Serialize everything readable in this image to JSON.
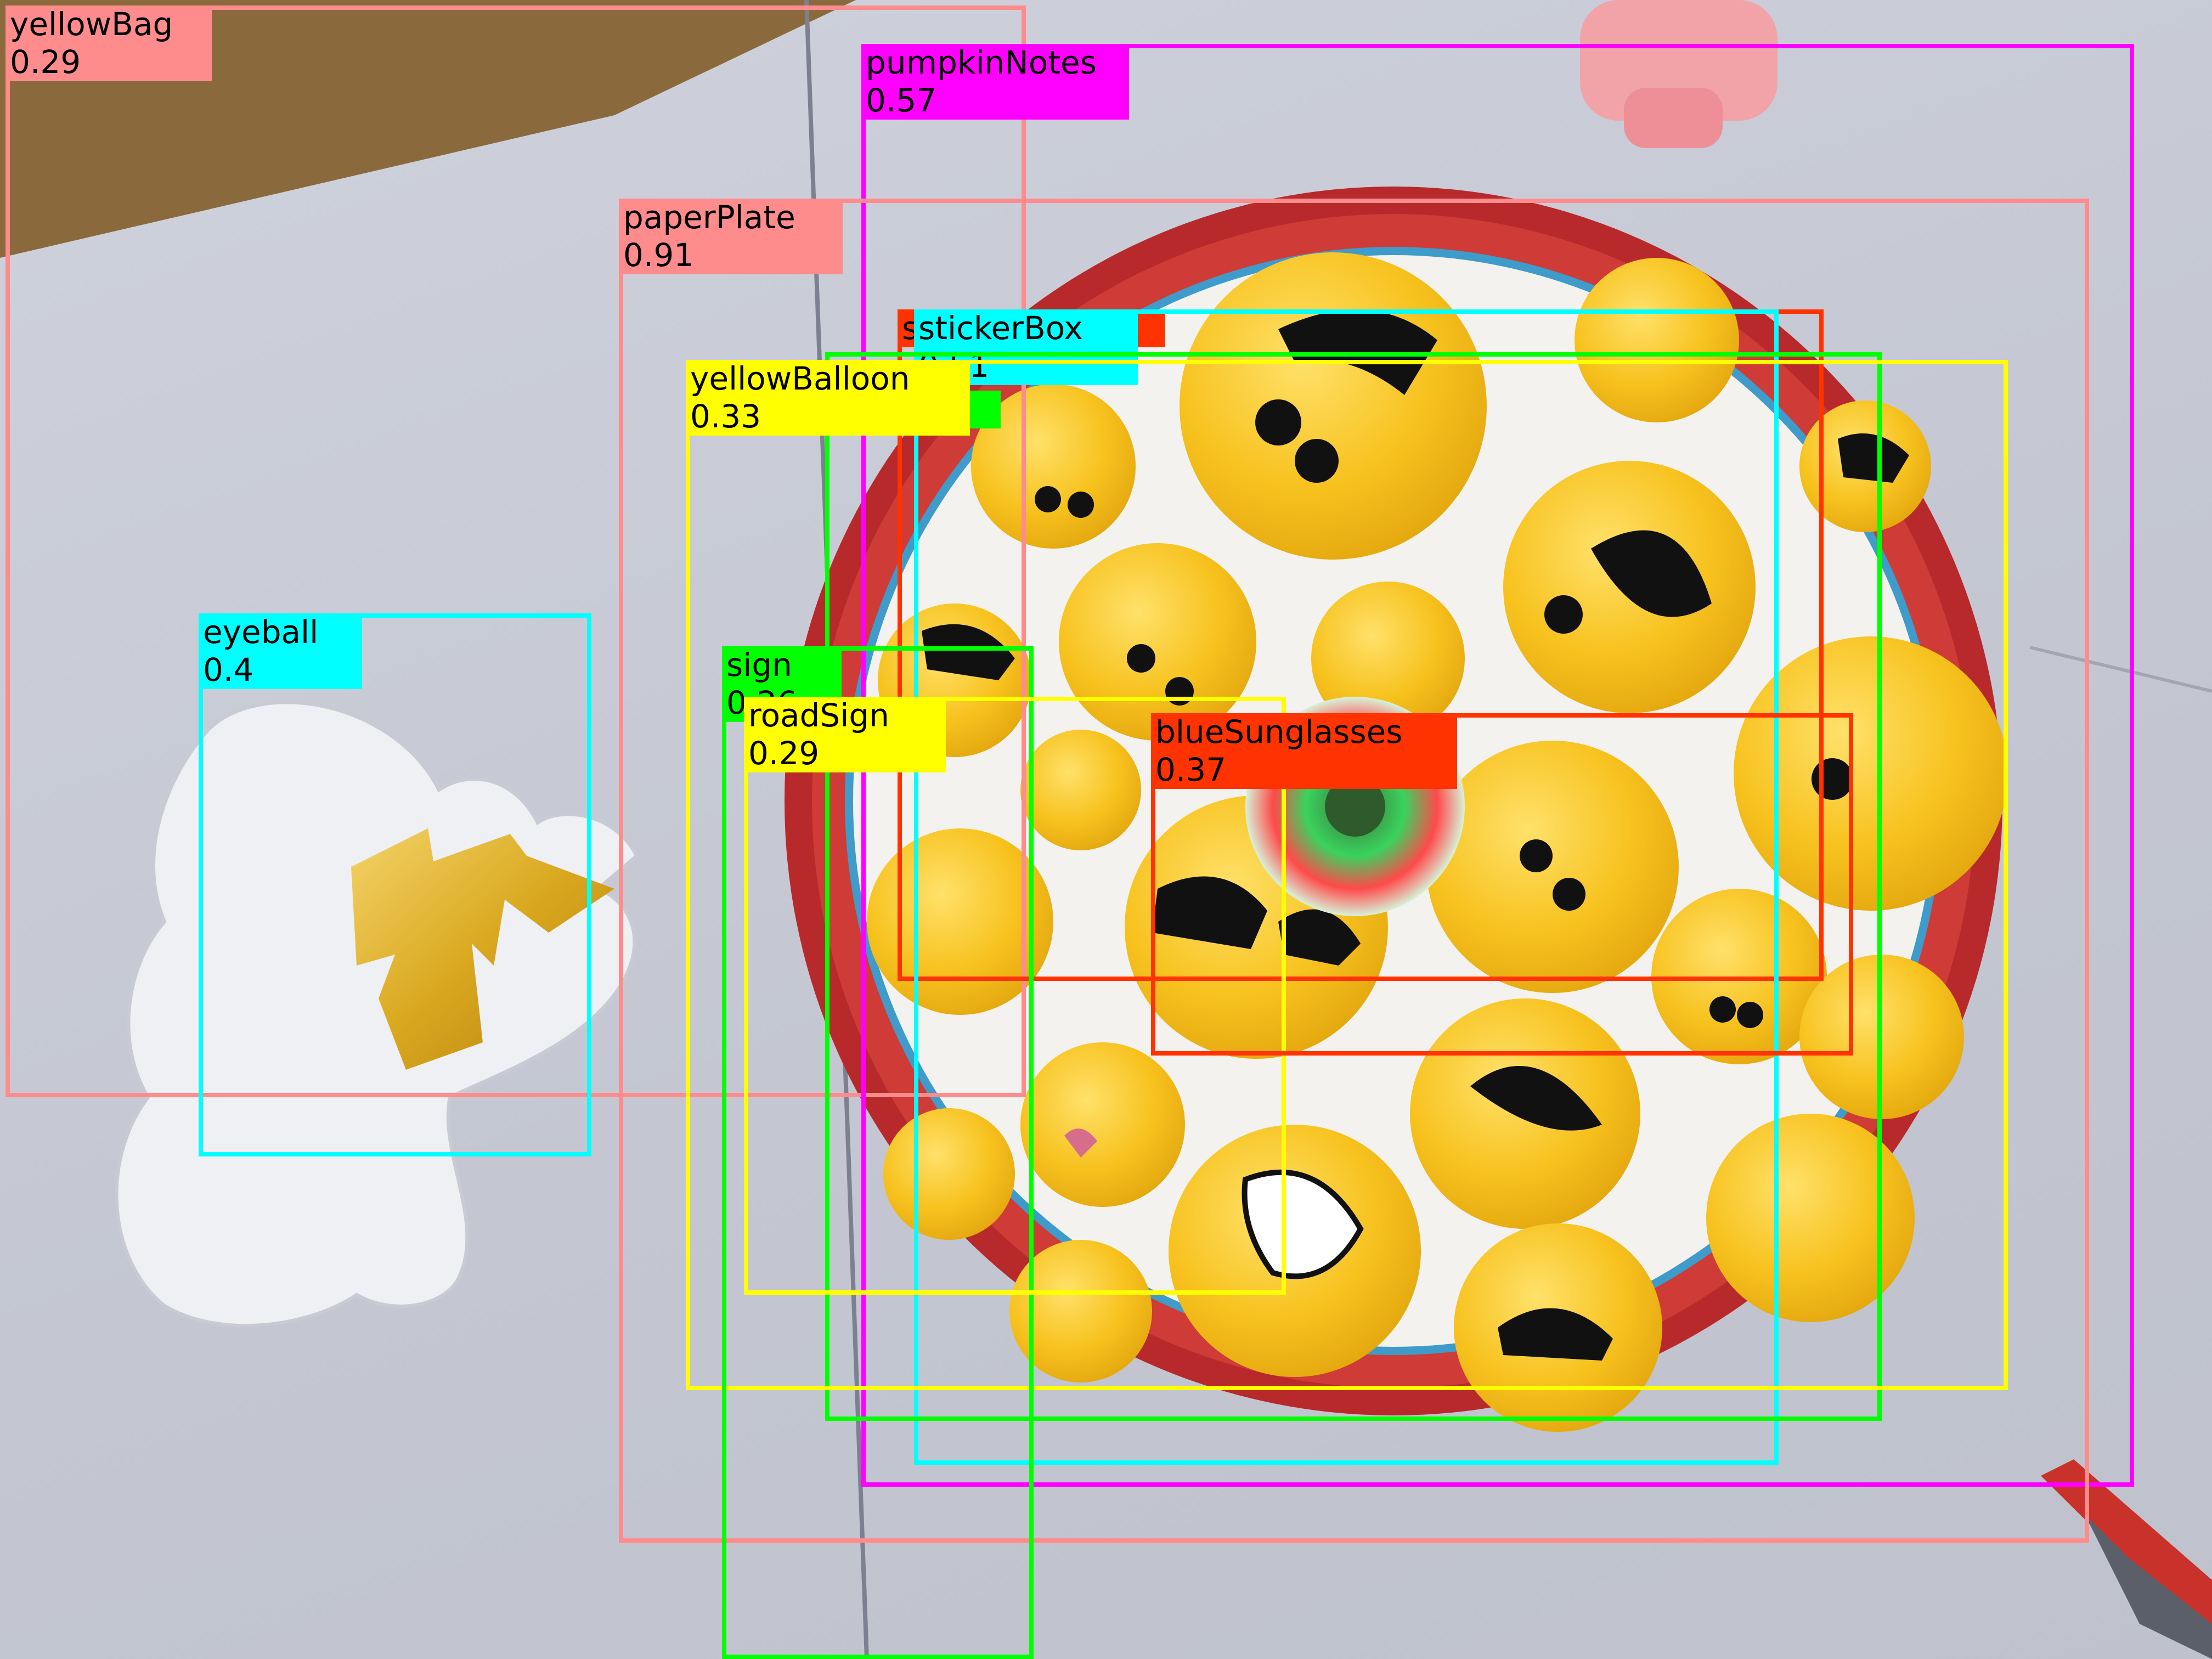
{
  "detections": [
    {
      "label": "yellowBag",
      "score": "0.29",
      "color": "#FF8C8C"
    },
    {
      "label": "pumpkinNotes",
      "score": "0.57",
      "color": "#FF00FF"
    },
    {
      "label": "paperPlate",
      "score": "0.91",
      "color": "#FF8C8C"
    },
    {
      "label": "sticker",
      "score": "",
      "color": "#FF3300"
    },
    {
      "label": "stickerBox",
      "score": "0.51",
      "color": "#00FFFF"
    },
    {
      "label": "",
      "score": "",
      "color": "#00FF00"
    },
    {
      "label": "yellowBalloon",
      "score": "0.33",
      "color": "#FFFF00"
    },
    {
      "label": "eyeball",
      "score": "0.4",
      "color": "#00FFFF"
    },
    {
      "label": "sign",
      "score": "0.26",
      "color": "#00FF00"
    },
    {
      "label": "roadSign",
      "score": "0.29",
      "color": "#FFFF00"
    },
    {
      "label": "blueSunglasses",
      "score": "0.37",
      "color": "#FF3300"
    }
  ]
}
